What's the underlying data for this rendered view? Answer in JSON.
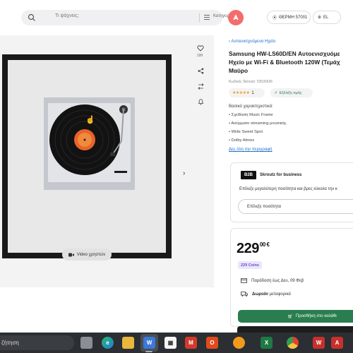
{
  "header": {
    "search_placeholder": "Τι ψάχνεις;",
    "categories_label": "Κατηγορίες",
    "location_label": "ΘΕΡΜΗ 57001",
    "language_label": "EL"
  },
  "gallery": {
    "like_count": "199",
    "video_button_label": "Video χρηστών",
    "next_arrow": "›"
  },
  "product": {
    "breadcrumb": "Αυτοενισχυόμενα Ηχεία",
    "title_lines": [
      "Samsung HW-LS60D/EN Αυτοενισχυόμε",
      "Ηχείο με Wi-Fi & Bluetooth 120W (Τεμάχ",
      "Μαύρο"
    ],
    "code": "Κωδικός Skroutz: 53535636",
    "rating_stars": "★★★★★",
    "rating_count": "1",
    "reviews_link": "Εξέλιξη τιμής",
    "features_heading": "Βασικά χαρακτηριστικά:",
    "features": [
      "Σχεδίαση Music Frame",
      "Ασύρματο streaming μουσικής",
      "Wide Sweet Spot",
      "Dolby Atmos"
    ],
    "more_link": "Δες όλη την περιγραφή"
  },
  "business": {
    "badge": "B2B",
    "title": "Skroutz for business",
    "text": "Επίλεξε μεγαλύτερη ποσότητα και βρες εύκολα την κ",
    "quantity_label": "Επίλεξε ποσότητα"
  },
  "purchase": {
    "price_main": "229",
    "price_cents": "00 €",
    "coins": "229 Coins",
    "delivery": "Παράδοση έως Δευ, 09 Φεβ",
    "free_label": "Δωρεάν",
    "shipping_suffix": "μεταφορικά",
    "cart_button": "Προσθήκη στο καλάθι"
  },
  "taskbar": {
    "search_text": "ζήτηση"
  },
  "colors": {
    "accent_green": "#2a7d4f",
    "link_blue": "#1f6fc8",
    "brand_coral": "#f36d6c",
    "star_orange": "#f29b1e",
    "coins_purple": "#6e46d6"
  }
}
